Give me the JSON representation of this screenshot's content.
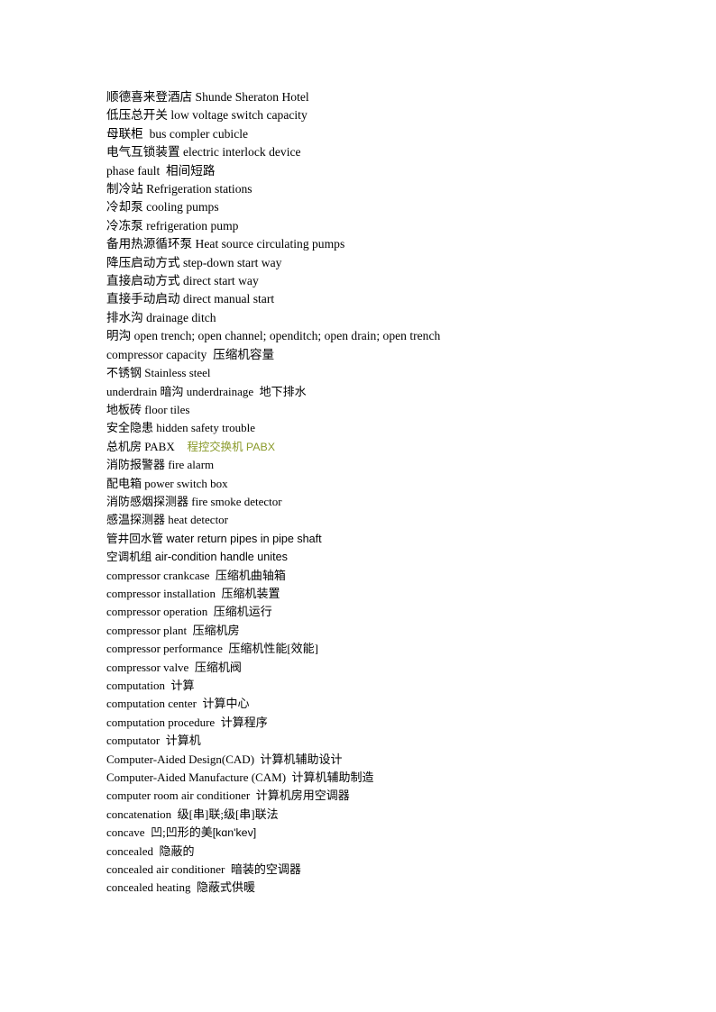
{
  "page": {
    "background_color": "#ffffff",
    "text_color": "#000000",
    "accent_color": "#8a9a2a"
  },
  "glossary": {
    "entries": [
      {
        "text": "顺德喜来登酒店 Shunde Sheraton Hotel"
      },
      {
        "text": "低压总开关 low voltage switch capacity"
      },
      {
        "text": "母联柜  bus compler cubicle"
      },
      {
        "text": "电气互锁装置 electric interlock device"
      },
      {
        "text": "phase fault  相间短路"
      },
      {
        "text": "制冷站 Refrigeration stations"
      },
      {
        "text": "冷却泵 cooling pumps"
      },
      {
        "text": "冷冻泵 refrigeration pump"
      },
      {
        "text": "备用热源循环泵 Heat source circulating pumps"
      },
      {
        "text": "降压启动方式 step-down start way"
      },
      {
        "text": "直接启动方式 direct start way"
      },
      {
        "text": "直接手动启动 direct manual start"
      },
      {
        "text": "排水沟 drainage ditch"
      },
      {
        "text": "明沟 open trench; open channel; openditch; open drain; open trench"
      },
      {
        "text": "compressor capacity  压缩机容量"
      },
      {
        "text": "不锈钢 Stainless steel"
      },
      {
        "text": "underdrain 暗沟 underdrainage  地下排水"
      },
      {
        "text": "地板砖 floor tiles"
      },
      {
        "text": "安全隐患 hidden safety trouble"
      },
      {
        "text": "总机房 PABX",
        "suffix_green": "    程控交换机 PABX"
      },
      {
        "text": "消防报警器 fire alarm"
      },
      {
        "text": "配电箱 power switch box"
      },
      {
        "text": "消防感烟探测器 fire smoke detector"
      },
      {
        "text": "感温探测器 heat detector"
      },
      {
        "text": "管井回水管 water return pipes in pipe shaft",
        "sans": true
      },
      {
        "text": "空调机组 air-condition handle unites",
        "sans": true
      },
      {
        "text": "compressor crankcase  压缩机曲轴箱"
      },
      {
        "text": "compressor installation  压缩机装置"
      },
      {
        "text": "compressor operation  压缩机运行"
      },
      {
        "text": "compressor plant  压缩机房"
      },
      {
        "text": "compressor performance  压缩机性能[效能]"
      },
      {
        "text": "compressor valve  压缩机阀"
      },
      {
        "text": "computation  计算"
      },
      {
        "text": "computation center  计算中心"
      },
      {
        "text": "computation procedure  计算程序"
      },
      {
        "text": "computator  计算机"
      },
      {
        "text": "Computer-Aided Design(CAD)  计算机辅助设计"
      },
      {
        "text": "Computer-Aided Manufacture (CAM)  计算机辅助制造"
      },
      {
        "text": "computer room air conditioner  计算机房用空调器"
      },
      {
        "text": "concatenation  级[串]联;级[串]联法"
      },
      {
        "text": "concave  凹;凹形的美",
        "suffix_ipa": "[kɑn'kev]"
      },
      {
        "text": "concealed  隐蔽的"
      },
      {
        "text": "concealed air conditioner  暗装的空调器"
      },
      {
        "text": "concealed heating  隐蔽式供暖"
      }
    ]
  }
}
